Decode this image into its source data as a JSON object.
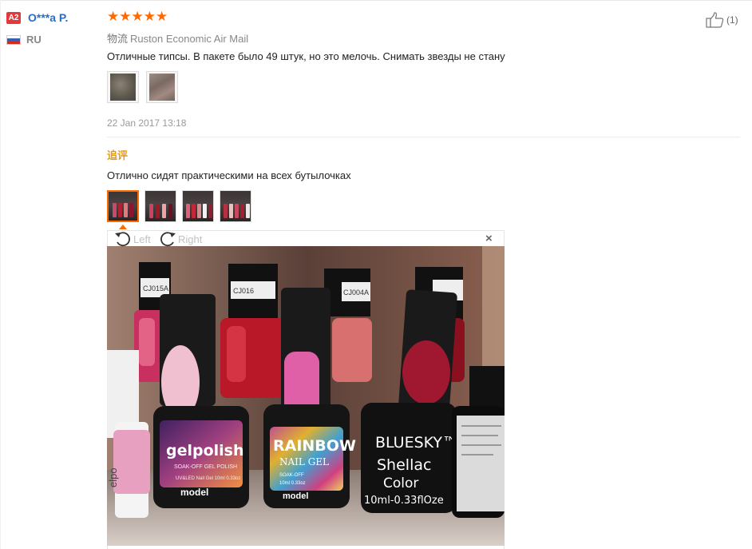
{
  "reviewer": {
    "badge": "A2",
    "name": "O***a P.",
    "country": "RU",
    "flag_colors": [
      "#ffffff",
      "#3a5fb0",
      "#d52b1e"
    ]
  },
  "review": {
    "rating": 5,
    "star_char": "★",
    "star_color": "#ff6a00",
    "shipping_label": "物流",
    "shipping_method": "Ruston Economic Air Mail",
    "text": "Отличные типсы. В пакете было 49 штук, но это мелочь. Снимать звезды не стану",
    "date": "22 Jan 2017 13:18",
    "likes": "(1)"
  },
  "followup": {
    "label": "追评",
    "label_color": "#e39a1a",
    "text": "Отлично сидят практическими на всех бутылочках"
  },
  "viewer": {
    "left_label": "Left",
    "right_label": "Right",
    "close_char": "×"
  },
  "photo_labels": {
    "top1": "CJ015A",
    "top2": "CJ016",
    "top3": "CJ004A",
    "b1_brand": "gelpolish",
    "b1_sub": "SOAK-OFF GEL POLISH",
    "b1_vol": "UV&LED Nail Gel 10ml 0.33oz",
    "b1_model": "model",
    "b2_line1": "RAINBOW",
    "b2_line2": "NAIL GEL",
    "b2_sub": "SOAK-OFF",
    "b2_vol": "10ml 0.33oz",
    "b2_model": "model",
    "b3_line1": "BLUESKY™",
    "b3_line2": "Shellac",
    "b3_line3": "Color",
    "b3_line4": "10ml-0.33flOze",
    "left_partial": "elpo"
  }
}
